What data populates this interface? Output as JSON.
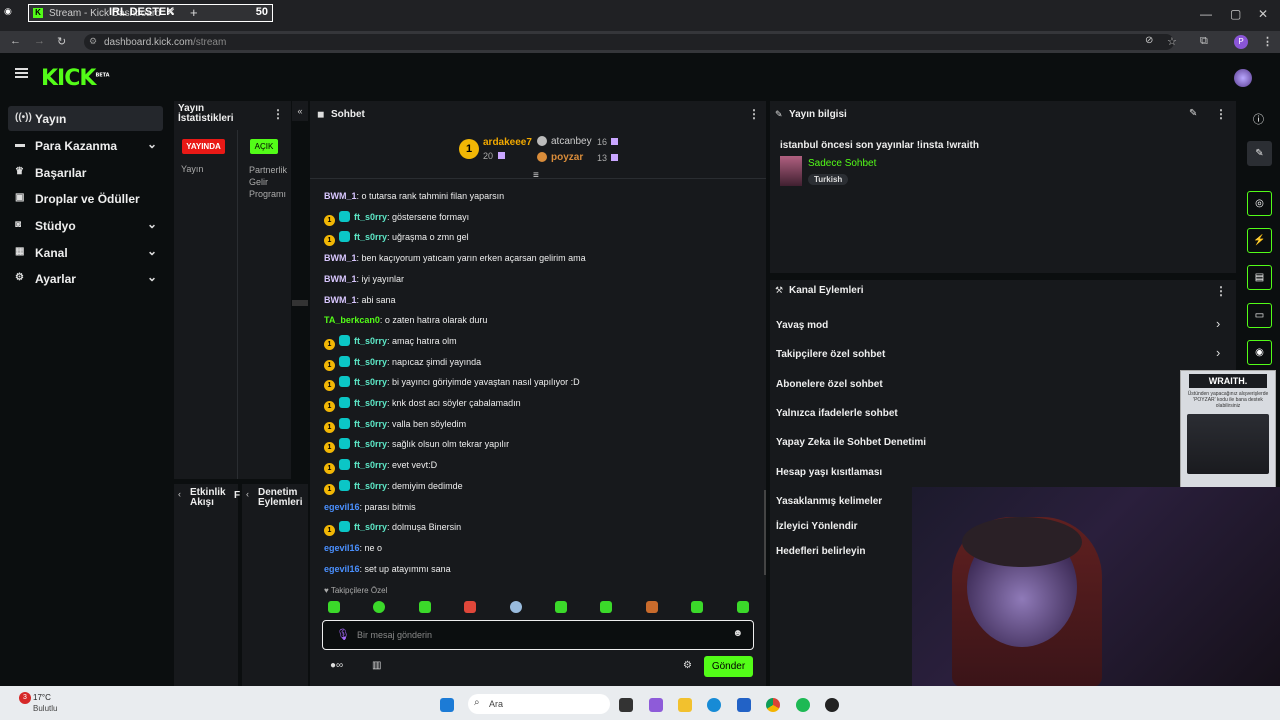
{
  "browser": {
    "tab_title": "Stream - Kick Dashboard",
    "overlay_title": "IRL DESTEK",
    "overlay_count": "50",
    "url_host": "dashboard.kick.com",
    "url_path": "/stream"
  },
  "sidebar": {
    "items": [
      {
        "label": "Yayın",
        "icon": "broadcast-icon"
      },
      {
        "label": "Para Kazanma",
        "icon": "money-icon"
      },
      {
        "label": "Başarılar",
        "icon": "trophy-icon"
      },
      {
        "label": "Droplar ve Ödüller",
        "icon": "gift-icon"
      },
      {
        "label": "Stüdyo",
        "icon": "studio-icon"
      },
      {
        "label": "Kanal",
        "icon": "channel-icon"
      },
      {
        "label": "Ayarlar",
        "icon": "gear-icon"
      }
    ]
  },
  "stats": {
    "title": "Yayın İstatistikleri",
    "live": "YAYINDA",
    "open": "AÇIK",
    "col1": "Yayın",
    "col2": "Partnerlik Gelir Programı"
  },
  "bottom_panels": {
    "activity": "Etkinlik Akışı",
    "moderation": "Denetim Eylemleri"
  },
  "chat": {
    "title": "Sohbet",
    "leaderboard": [
      {
        "name": "ardakeee7",
        "score": "20"
      },
      {
        "name": "atcanbey",
        "score": "16"
      },
      {
        "name": "poyzar",
        "score": "13"
      }
    ],
    "messages": [
      {
        "user": "BWM_1",
        "text": "o tutarsa rank tahmini filan yaparsın",
        "color": "#d9c7ff",
        "badges": false
      },
      {
        "user": "ft_s0rry",
        "text": "göstersene formayı",
        "color": "#5de8c7",
        "badges": true
      },
      {
        "user": "ft_s0rry",
        "text": "uğraşma o zmn gel",
        "color": "#5de8c7",
        "badges": true
      },
      {
        "user": "BWM_1",
        "text": "ben kaçıyorum yatıcam yarın erken açarsan gelirim ama",
        "color": "#d9c7ff",
        "badges": false
      },
      {
        "user": "BWM_1",
        "text": "iyi yayınlar",
        "color": "#d9c7ff",
        "badges": false
      },
      {
        "user": "BWM_1",
        "text": "abi sana",
        "color": "#d9c7ff",
        "badges": false
      },
      {
        "user": "TA_berkcan0",
        "text": "o zaten hatıra olarak duru",
        "color": "#53fc18",
        "badges": false
      },
      {
        "user": "ft_s0rry",
        "text": "amaç hatıra olm",
        "color": "#5de8c7",
        "badges": true
      },
      {
        "user": "ft_s0rry",
        "text": "napıcaz şimdi yayında",
        "color": "#5de8c7",
        "badges": true
      },
      {
        "user": "ft_s0rry",
        "text": "bi yayıncı göriyimde yavaştan nasıl yapılıyor :D",
        "color": "#5de8c7",
        "badges": true
      },
      {
        "user": "ft_s0rry",
        "text": "knk dost acı söyler çabalamadın",
        "color": "#5de8c7",
        "badges": true
      },
      {
        "user": "ft_s0rry",
        "text": "valla ben söyledim",
        "color": "#5de8c7",
        "badges": true
      },
      {
        "user": "ft_s0rry",
        "text": "sağlık olsun olm tekrar yapılır",
        "color": "#5de8c7",
        "badges": true
      },
      {
        "user": "ft_s0rry",
        "text": "evet vevt:D",
        "color": "#5de8c7",
        "badges": true
      },
      {
        "user": "ft_s0rry",
        "text": "demiyim dedimde",
        "color": "#5de8c7",
        "badges": true
      },
      {
        "user": "egevil16",
        "text": "parası bitmis",
        "color": "#4a90ff",
        "badges": false
      },
      {
        "user": "ft_s0rry",
        "text": "dolmuşa Binersin",
        "color": "#5de8c7",
        "badges": true
      },
      {
        "user": "egevil16",
        "text": "ne o",
        "color": "#4a90ff",
        "badges": false
      },
      {
        "user": "egevil16",
        "text": "set up atayımmı sana",
        "color": "#4a90ff",
        "badges": false
      }
    ],
    "followers_only": "Takipçilere Özel",
    "placeholder": "Bir mesaj gönderin",
    "send": "Gönder"
  },
  "stream_info": {
    "title": "Yayın bilgisi",
    "stream_title": "istanbul öncesi son yayınlar !insta !wraith",
    "category": "Sadece Sohbet",
    "tag": "Turkish"
  },
  "channel_actions": {
    "title": "Kanal Eylemleri",
    "items": [
      "Yavaş mod",
      "Takipçilere özel sohbet",
      "Abonelere özel sohbet",
      "Yalnızca ifadelerle sohbet",
      "Yapay Zeka ile Sohbet Denetimi",
      "Hesap yaşı kısıtlaması",
      "Yasaklanmış kelimeler",
      "İzleyici Yönlendir",
      "Hedefleri belirleyin"
    ]
  },
  "ad": {
    "brand": "WRAITH.",
    "text": "Üstünden yapacağınız alışverişlerde 'POYZAR' kodu ile bana destek olabilirsiniz"
  },
  "taskbar": {
    "temp": "17°C",
    "weather": "Bulutlu",
    "notif": "3",
    "search": "Ara"
  }
}
